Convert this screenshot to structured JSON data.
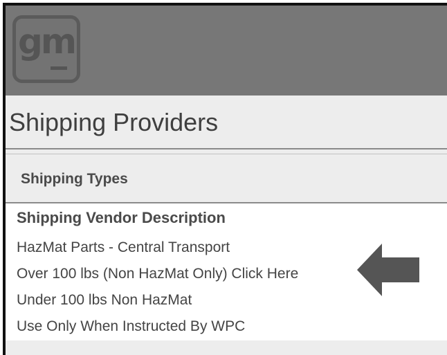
{
  "app": {
    "logo_text": "gm"
  },
  "page": {
    "title": "Shipping Providers"
  },
  "types_section": {
    "label": "Shipping Types"
  },
  "vendor_table": {
    "column_header": "Shipping Vendor Description",
    "rows": [
      "HazMat Parts - Central Transport",
      "Over 100 lbs (Non HazMat Only) Click Here",
      "Under 100 lbs Non HazMat",
      "Use Only When Instructed By WPC"
    ]
  },
  "annotation": {
    "icon": "left-arrow-icon",
    "color": "#555555"
  },
  "colors": {
    "header_bg": "#777777",
    "panel_bg": "#ededed",
    "text": "#444444"
  }
}
